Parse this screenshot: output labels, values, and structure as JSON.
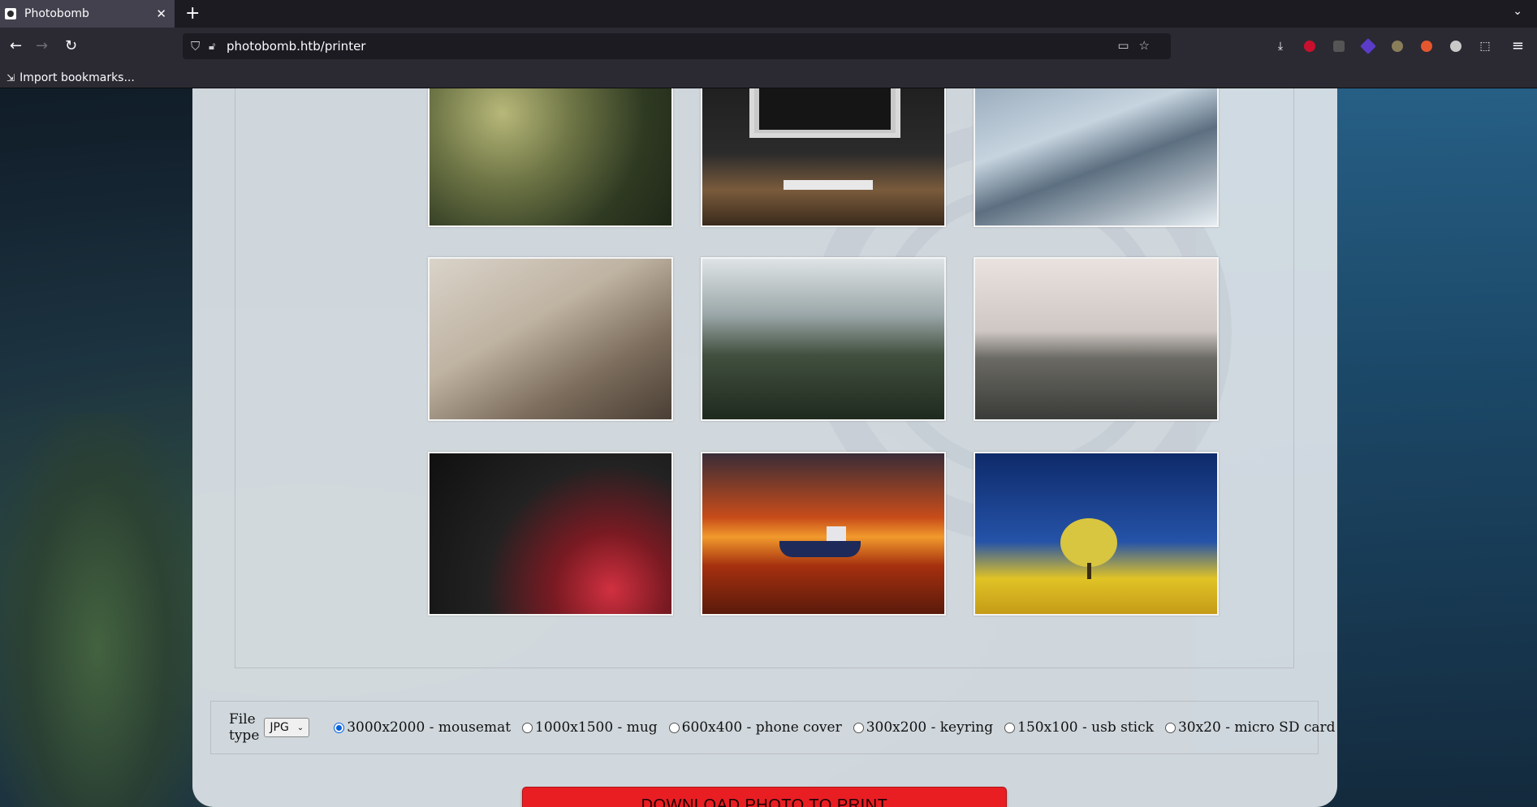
{
  "browser": {
    "tab": {
      "title": "Photobomb",
      "close_glyph": "✕"
    },
    "newtab_glyph": "+",
    "tablist_glyph": "⌄",
    "nav": {
      "back_glyph": "←",
      "forward_glyph": "→",
      "reload_glyph": "↻"
    },
    "url": "photobomb.htb/printer",
    "bookmarks": {
      "import_label": "Import bookmarks..."
    },
    "menu_glyph": "≡"
  },
  "page": {
    "photos": [
      {
        "name": "succulent-plants",
        "icon": "photo"
      },
      {
        "name": "desk-monitor",
        "icon": "photo"
      },
      {
        "name": "frozen-waterfall",
        "icon": "photo"
      },
      {
        "name": "woodworking-tools",
        "icon": "photo"
      },
      {
        "name": "glass-greenhouse",
        "icon": "photo"
      },
      {
        "name": "coastal-cliffs",
        "icon": "photo"
      },
      {
        "name": "red-abstract-curves",
        "icon": "photo"
      },
      {
        "name": "boat-at-sunset",
        "icon": "photo"
      },
      {
        "name": "yellow-tree-field",
        "icon": "photo"
      }
    ],
    "form": {
      "file_type_label": "File type",
      "file_type_value": "JPG",
      "sizes": [
        {
          "label": "3000x2000 - mousemat",
          "checked": true
        },
        {
          "label": "1000x1500 - mug",
          "checked": false
        },
        {
          "label": "600x400 - phone cover",
          "checked": false
        },
        {
          "label": "300x200 - keyring",
          "checked": false
        },
        {
          "label": "150x100 - usb stick",
          "checked": false
        },
        {
          "label": "30x20 - micro SD card",
          "checked": false
        }
      ]
    },
    "download_label": "DOWNLOAD PHOTO TO PRINT",
    "colors": {
      "button": "#e81e23",
      "radio_accent": "#0060df"
    }
  }
}
